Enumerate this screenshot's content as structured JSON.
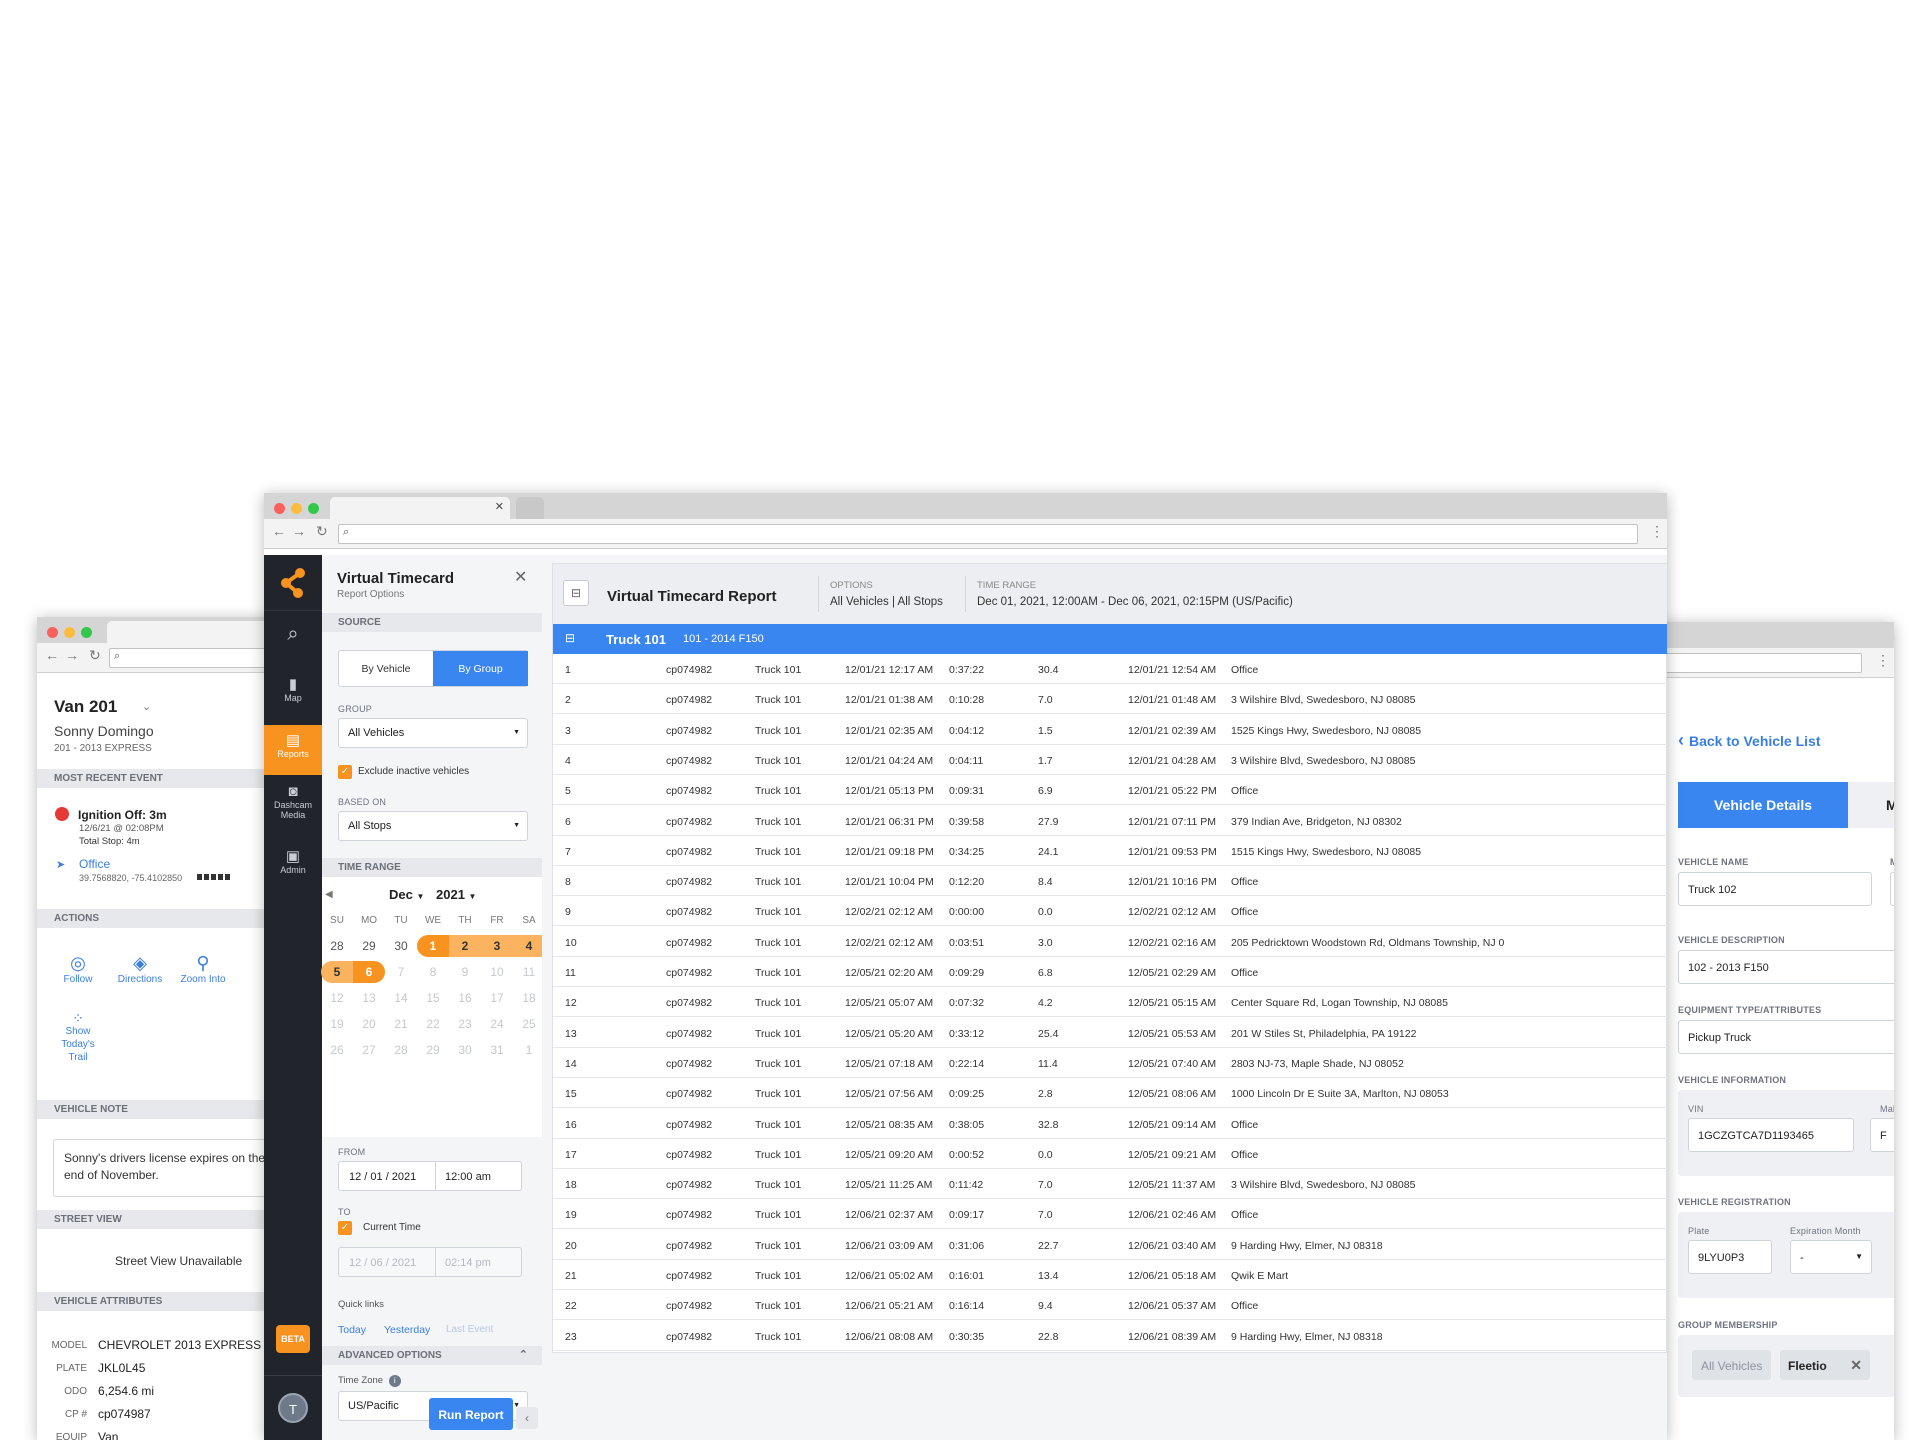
{
  "left_window": {
    "vehicle_name": "Van 201",
    "driver": "Sonny Domingo",
    "vehicle_sub": "201 - 2013 EXPRESS",
    "most_recent_event_header": "MOST RECENT EVENT",
    "event_title": "Ignition Off: 3m",
    "event_time": "12/6/21 @ 02:08PM",
    "event_stop": "Total Stop: 4m",
    "location": "Office",
    "coords": "39.7568820, -75.4102850",
    "actions_header": "ACTIONS",
    "actions": [
      "Follow",
      "Directions",
      "Zoom Into"
    ],
    "trail_action": [
      "Show",
      "Today's",
      "Trail"
    ],
    "vehicle_note_header": "VEHICLE NOTE",
    "note": "Sonny's drivers license expires on the end of November.",
    "street_view_header": "STREET VIEW",
    "street_view_text": "Street View Unavailable",
    "attributes_header": "VEHICLE ATTRIBUTES",
    "attributes": [
      {
        "label": "MODEL",
        "value": "CHEVROLET 2013 EXPRESS"
      },
      {
        "label": "PLATE",
        "value": "JKL0L45"
      },
      {
        "label": "ODO",
        "value": "6,254.6 mi"
      },
      {
        "label": "CP #",
        "value": "cp074987"
      },
      {
        "label": "EQUIP",
        "value": "Van"
      }
    ]
  },
  "right_window": {
    "back_link": "Back to Vehicle List",
    "active_tab": "Vehicle Details",
    "next_tab_partial": "M",
    "name_label": "VEHICLE NAME",
    "name_value": "Truck 102",
    "name_side_label": "M",
    "desc_label": "VEHICLE DESCRIPTION",
    "desc_value": "102 - 2013 F150",
    "equip_label": "EQUIPMENT TYPE/ATTRIBUTES",
    "equip_value": "Pickup Truck",
    "info_label": "VEHICLE INFORMATION",
    "vin_label": "VIN",
    "vin_value": "1GCZGTCA7D1193465",
    "make_label": "Mal",
    "make_value": "F",
    "reg_label": "VEHICLE REGISTRATION",
    "plate_label": "Plate",
    "plate_value": "9LYU0P3",
    "exp_label": "Expiration Month",
    "exp_value": "-",
    "group_label": "GROUP MEMBERSHIP",
    "groups": [
      "All Vehicles",
      "Fleetio"
    ]
  },
  "sidebar": {
    "items": [
      {
        "label": "",
        "icon": "search-icon"
      },
      {
        "label": "Map",
        "icon": "map-icon"
      },
      {
        "label": "Reports",
        "icon": "document-icon"
      },
      {
        "label": "Dashcam Media",
        "icon": "camera-icon"
      },
      {
        "label": "Admin",
        "icon": "admin-icon"
      }
    ],
    "beta": "BETA",
    "avatar": "T",
    "accent": "#f7931e"
  },
  "options_panel": {
    "title": "Virtual Timecard",
    "subtitle": "Report Options",
    "source_header": "SOURCE",
    "source_options": [
      "By Vehicle",
      "By Group"
    ],
    "group_label": "GROUP",
    "group_value": "All Vehicles",
    "exclude_label": "Exclude inactive vehicles",
    "based_on_label": "BASED ON",
    "based_on_value": "All Stops",
    "time_range_header": "TIME RANGE",
    "month": "Dec",
    "year": "2021",
    "weekdays": [
      "SU",
      "MO",
      "TU",
      "WE",
      "TH",
      "FR",
      "SA"
    ],
    "calendar_rows": [
      [
        "28",
        "29",
        "30",
        "1",
        "2",
        "3",
        "4"
      ],
      [
        "5",
        "6",
        "7",
        "8",
        "9",
        "10",
        "11"
      ],
      [
        "12",
        "13",
        "14",
        "15",
        "16",
        "17",
        "18"
      ],
      [
        "19",
        "20",
        "21",
        "22",
        "23",
        "24",
        "25"
      ],
      [
        "26",
        "27",
        "28",
        "29",
        "30",
        "31",
        "1"
      ]
    ],
    "from_label": "FROM",
    "from_date": "12 / 01 / 2021",
    "from_time": "12:00 am",
    "to_label": "TO",
    "current_time_label": "Current Time",
    "to_date": "12 / 06 / 2021",
    "to_time": "02:14 pm",
    "quick_links_label": "Quick links",
    "quick_links": [
      "Today",
      "Yesterday",
      "Last Event"
    ],
    "advanced_header": "ADVANCED OPTIONS",
    "timezone_label": "Time Zone",
    "timezone_value": "US/Pacific",
    "run_button": "Run Report"
  },
  "report": {
    "title": "Virtual Timecard Report",
    "options_label": "OPTIONS",
    "options_value": "All Vehicles | All Stops",
    "time_range_label": "TIME RANGE",
    "time_range_value": "Dec 01, 2021, 12:00AM - Dec 06, 2021, 02:15PM (US/Pacific)",
    "group_name": "Truck 101",
    "group_desc": "101 - 2014 F150",
    "accent": "#3a86f0",
    "rows": [
      [
        "1",
        "cp074982",
        "Truck 101",
        "12/01/21 12:17 AM",
        "0:37:22",
        "30.4",
        "12/01/21 12:54 AM",
        "Office"
      ],
      [
        "2",
        "cp074982",
        "Truck 101",
        "12/01/21 01:38 AM",
        "0:10:28",
        "7.0",
        "12/01/21 01:48 AM",
        "3 Wilshire Blvd, Swedesboro, NJ 08085"
      ],
      [
        "3",
        "cp074982",
        "Truck 101",
        "12/01/21 02:35 AM",
        "0:04:12",
        "1.5",
        "12/01/21 02:39 AM",
        "1525 Kings Hwy, Swedesboro, NJ 08085"
      ],
      [
        "4",
        "cp074982",
        "Truck 101",
        "12/01/21 04:24 AM",
        "0:04:11",
        "1.7",
        "12/01/21 04:28 AM",
        "3 Wilshire Blvd, Swedesboro, NJ 08085"
      ],
      [
        "5",
        "cp074982",
        "Truck 101",
        "12/01/21 05:13 PM",
        "0:09:31",
        "6.9",
        "12/01/21 05:22 PM",
        "Office"
      ],
      [
        "6",
        "cp074982",
        "Truck 101",
        "12/01/21 06:31 PM",
        "0:39:58",
        "27.9",
        "12/01/21 07:11 PM",
        "379 Indian Ave, Bridgeton, NJ 08302"
      ],
      [
        "7",
        "cp074982",
        "Truck 101",
        "12/01/21 09:18 PM",
        "0:34:25",
        "24.1",
        "12/01/21 09:53 PM",
        "1515 Kings Hwy, Swedesboro, NJ 08085"
      ],
      [
        "8",
        "cp074982",
        "Truck 101",
        "12/01/21 10:04 PM",
        "0:12:20",
        "8.4",
        "12/01/21 10:16 PM",
        "Office"
      ],
      [
        "9",
        "cp074982",
        "Truck 101",
        "12/02/21 02:12 AM",
        "0:00:00",
        "0.0",
        "12/02/21 02:12 AM",
        "Office"
      ],
      [
        "10",
        "cp074982",
        "Truck 101",
        "12/02/21 02:12 AM",
        "0:03:51",
        "3.0",
        "12/02/21 02:16 AM",
        "205 Pedricktown Woodstown Rd, Oldmans Township, NJ 0"
      ],
      [
        "11",
        "cp074982",
        "Truck 101",
        "12/05/21 02:20 AM",
        "0:09:29",
        "6.8",
        "12/05/21 02:29 AM",
        "Office"
      ],
      [
        "12",
        "cp074982",
        "Truck 101",
        "12/05/21 05:07 AM",
        "0:07:32",
        "4.2",
        "12/05/21 05:15 AM",
        "Center Square Rd, Logan Township, NJ 08085"
      ],
      [
        "13",
        "cp074982",
        "Truck 101",
        "12/05/21 05:20 AM",
        "0:33:12",
        "25.4",
        "12/05/21 05:53 AM",
        "201 W Stiles St, Philadelphia, PA 19122"
      ],
      [
        "14",
        "cp074982",
        "Truck 101",
        "12/05/21 07:18 AM",
        "0:22:14",
        "11.4",
        "12/05/21 07:40 AM",
        "2803 NJ-73, Maple Shade, NJ 08052"
      ],
      [
        "15",
        "cp074982",
        "Truck 101",
        "12/05/21 07:56 AM",
        "0:09:25",
        "2.8",
        "12/05/21 08:06 AM",
        "1000 Lincoln Dr E Suite 3A, Marlton, NJ 08053"
      ],
      [
        "16",
        "cp074982",
        "Truck 101",
        "12/05/21 08:35 AM",
        "0:38:05",
        "32.8",
        "12/05/21 09:14 AM",
        "Office"
      ],
      [
        "17",
        "cp074982",
        "Truck 101",
        "12/05/21 09:20 AM",
        "0:00:52",
        "0.0",
        "12/05/21 09:21 AM",
        "Office"
      ],
      [
        "18",
        "cp074982",
        "Truck 101",
        "12/05/21 11:25 AM",
        "0:11:42",
        "7.0",
        "12/05/21 11:37 AM",
        "3 Wilshire Blvd, Swedesboro, NJ 08085"
      ],
      [
        "19",
        "cp074982",
        "Truck 101",
        "12/06/21 02:37 AM",
        "0:09:17",
        "7.0",
        "12/06/21 02:46 AM",
        "Office"
      ],
      [
        "20",
        "cp074982",
        "Truck 101",
        "12/06/21 03:09 AM",
        "0:31:06",
        "22.7",
        "12/06/21 03:40 AM",
        "9 Harding Hwy, Elmer, NJ 08318"
      ],
      [
        "21",
        "cp074982",
        "Truck 101",
        "12/06/21 05:02 AM",
        "0:16:01",
        "13.4",
        "12/06/21 05:18 AM",
        "Qwik E Mart"
      ],
      [
        "22",
        "cp074982",
        "Truck 101",
        "12/06/21 05:21 AM",
        "0:16:14",
        "9.4",
        "12/06/21 05:37 AM",
        "Office"
      ],
      [
        "23",
        "cp074982",
        "Truck 101",
        "12/06/21 08:08 AM",
        "0:30:35",
        "22.8",
        "12/06/21 08:39 AM",
        "9 Harding Hwy, Elmer, NJ 08318"
      ]
    ]
  }
}
